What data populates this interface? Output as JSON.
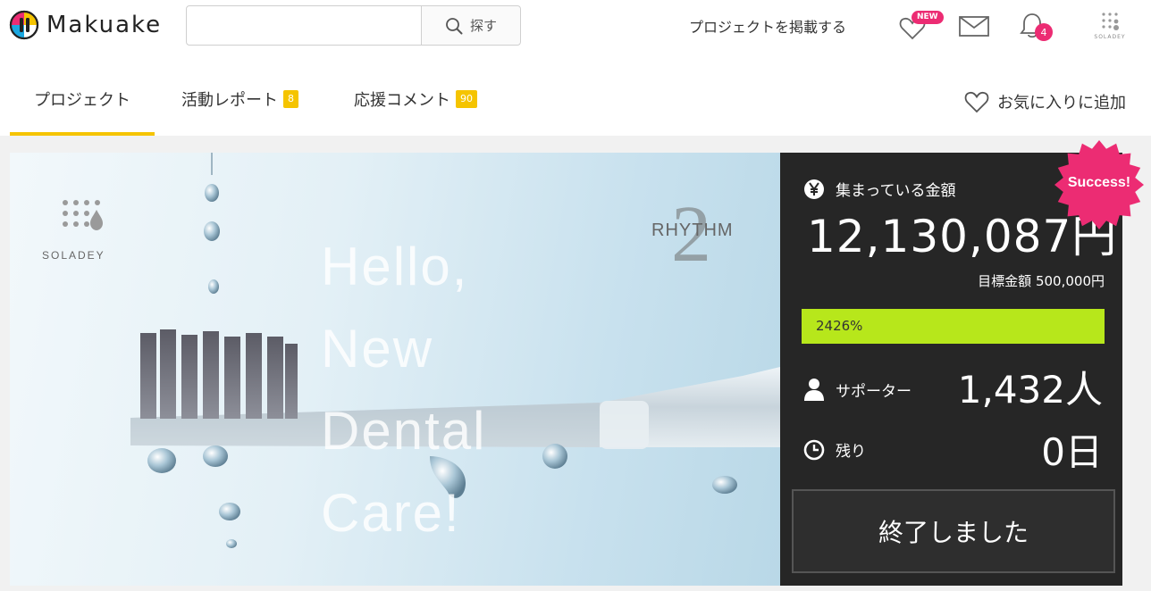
{
  "header": {
    "logo_text": "Makuake",
    "search": {
      "placeholder": "",
      "value": "",
      "button_label": "探す"
    },
    "post_project_link": "プロジェクトを掲載する",
    "favorites_badge": "NEW",
    "notification_count": "4",
    "brand_avatar_text": "SOLADEY"
  },
  "tabs": [
    {
      "label": "プロジェクト",
      "badge": "",
      "active": true
    },
    {
      "label": "活動レポート",
      "badge": "8",
      "active": false
    },
    {
      "label": "応援コメント",
      "badge": "90",
      "active": false
    }
  ],
  "favorite_add_label": "お気に入りに追加",
  "hero": {
    "brand": "SOLADEY",
    "product": "RHYTHM",
    "product_number": "2",
    "tagline": [
      "Hello,",
      "New",
      "Dental",
      "Care!"
    ]
  },
  "funding": {
    "success_label": "Success!",
    "raised_label": "集まっている金額",
    "raised_amount": "12,130,087円",
    "goal_label": "目標金額",
    "goal_amount": "500,000円",
    "progress_percent": 2426,
    "progress_text": "2426%",
    "supporters_label": "サポーター",
    "supporters_count": "1,432人",
    "remaining_label": "残り",
    "remaining_days": "0日",
    "status_button": "終了しました"
  },
  "colors": {
    "accent_yellow": "#f5c400",
    "badge_pink": "#ec2c73",
    "progress_green": "#b7e71b",
    "panel_bg": "#262626"
  }
}
